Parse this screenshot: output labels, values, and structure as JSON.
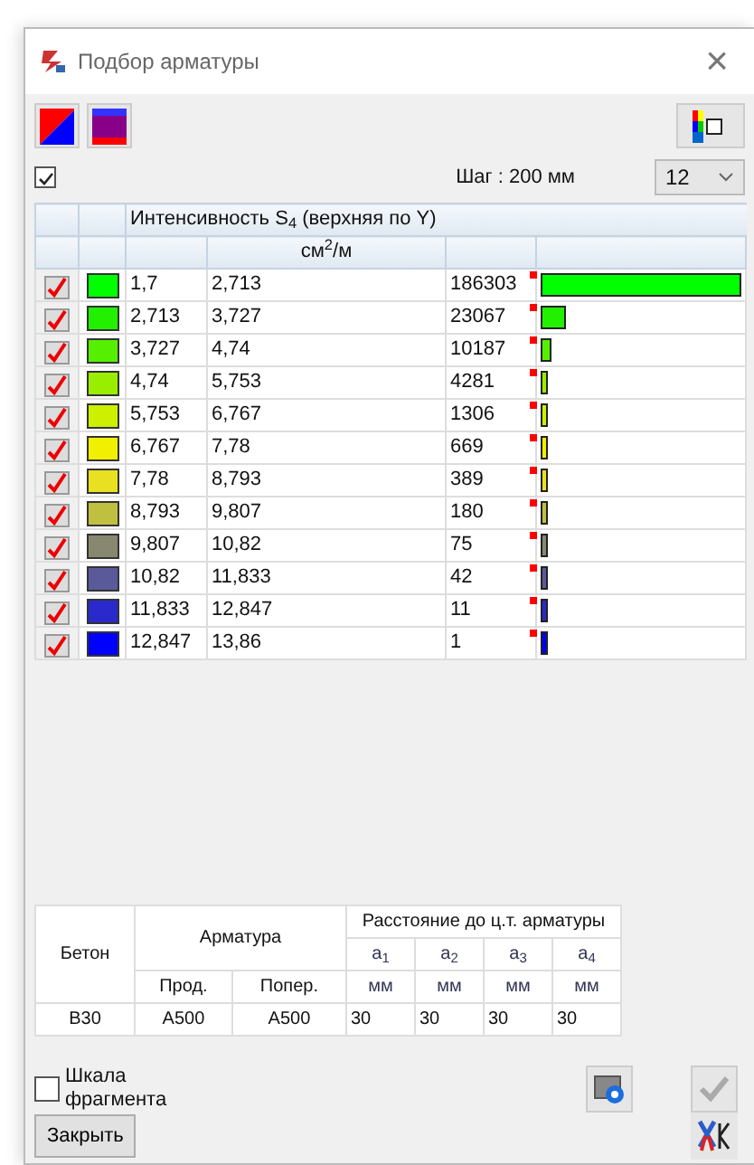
{
  "window": {
    "title": "Подбор арматуры",
    "close": "×"
  },
  "toolbar": {
    "show_checkbox": {
      "checked": true
    },
    "step_label": "Шаг : 200 мм",
    "count_select": {
      "value": "12"
    }
  },
  "table": {
    "header": "Интенсивность S$_{4}$ (верхняя по Y)",
    "units": "см$^{2}$/м",
    "rows": [
      {
        "checked": true,
        "color": "#00ff00",
        "from": "1,7",
        "to": "2,713",
        "count": "186303",
        "level": 1
      },
      {
        "checked": true,
        "color": "#22f000",
        "from": "2,713",
        "to": "3,727",
        "count": "23067",
        "level": 0.124
      },
      {
        "checked": true,
        "color": "#55f000",
        "from": "3,727",
        "to": "4,74",
        "count": "10187",
        "level": 0.055
      },
      {
        "checked": true,
        "color": "#99ee00",
        "from": "4,74",
        "to": "5,753",
        "count": "4281",
        "level": 0.023
      },
      {
        "checked": true,
        "color": "#ccf000",
        "from": "5,753",
        "to": "6,767",
        "count": "1306",
        "level": 0.007
      },
      {
        "checked": true,
        "color": "#f0f000",
        "from": "6,767",
        "to": "7,78",
        "count": "669",
        "level": 0.004
      },
      {
        "checked": true,
        "color": "#e8e020",
        "from": "7,78",
        "to": "8,793",
        "count": "389",
        "level": 0.002
      },
      {
        "checked": true,
        "color": "#c0c040",
        "from": "8,793",
        "to": "9,807",
        "count": "180",
        "level": 0.001
      },
      {
        "checked": true,
        "color": "#888870",
        "from": "9,807",
        "to": "10,82",
        "count": "75",
        "level": 0.0004
      },
      {
        "checked": true,
        "color": "#5a5a9a",
        "from": "10,82",
        "to": "11,833",
        "count": "42",
        "level": 0.0002
      },
      {
        "checked": true,
        "color": "#2a2acc",
        "from": "11,833",
        "to": "12,847",
        "count": "11",
        "level": 0.0001
      },
      {
        "checked": true,
        "color": "#0000ff",
        "from": "12,847",
        "to": "13,86",
        "count": "1",
        "level": 0
      }
    ]
  },
  "params": {
    "concrete_head": "Бетон",
    "rebar_head": "Арматура",
    "distance_head": "Расстояние до ц.т. арматуры",
    "a_heads": [
      "a$_{1}$",
      "a$_{2}$",
      "a$_{3}$",
      "a$_{4}$"
    ],
    "long_head": "Прод.",
    "trans_head": "Попер.",
    "units": [
      "мм",
      "мм",
      "мм",
      "мм"
    ],
    "concrete": "B30",
    "long": "A500",
    "trans": "A500",
    "distances": [
      "30",
      "30",
      "30",
      "30"
    ]
  },
  "scale_checkbox": {
    "label": "Шкала фрагмента",
    "checked": false
  },
  "close_button": "Закрыть"
}
